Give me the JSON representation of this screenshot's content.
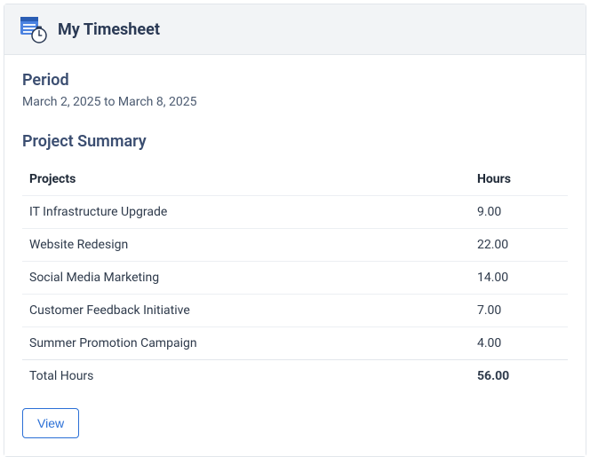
{
  "header": {
    "title": "My Timesheet"
  },
  "period": {
    "label": "Period",
    "value": "March 2, 2025 to March 8, 2025"
  },
  "summary": {
    "title": "Project Summary",
    "columns": {
      "projects": "Projects",
      "hours": "Hours"
    },
    "rows": [
      {
        "project": "IT Infrastructure Upgrade",
        "hours": "9.00"
      },
      {
        "project": "Website Redesign",
        "hours": "22.00"
      },
      {
        "project": "Social Media Marketing",
        "hours": "14.00"
      },
      {
        "project": "Customer Feedback Initiative",
        "hours": "7.00"
      },
      {
        "project": "Summer Promotion Campaign",
        "hours": "4.00"
      }
    ],
    "total": {
      "label": "Total Hours",
      "value": "56.00"
    }
  },
  "actions": {
    "view_label": "View"
  }
}
